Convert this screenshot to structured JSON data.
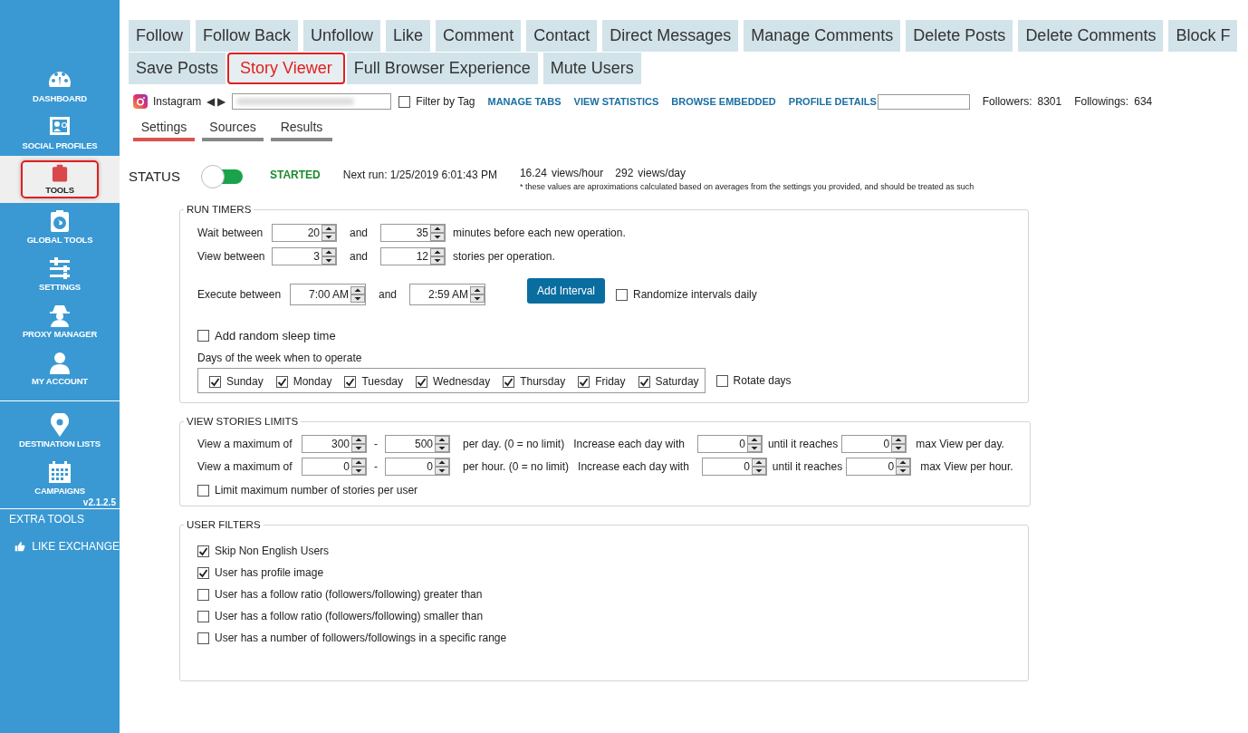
{
  "sidebar": {
    "groups": [
      [
        {
          "label": "DASHBOARD",
          "selected": false
        },
        {
          "label": "SOCIAL PROFILES",
          "selected": false
        },
        {
          "label": "TOOLS",
          "selected": true
        },
        {
          "label": "GLOBAL TOOLS",
          "selected": false
        },
        {
          "label": "SETTINGS",
          "selected": false
        },
        {
          "label": "PROXY MANAGER",
          "selected": false
        },
        {
          "label": "MY ACCOUNT",
          "selected": false
        }
      ],
      [
        {
          "label": "DESTINATION LISTS",
          "selected": false
        },
        {
          "label": "CAMPAIGNS",
          "selected": false
        }
      ]
    ],
    "version": "v2.1.2.5",
    "extra_title": "EXTRA TOOLS",
    "extra_items": [
      {
        "label": "LIKE EXCHANGE"
      }
    ]
  },
  "tab_rows": [
    [
      {
        "label": "Follow",
        "selected": false
      },
      {
        "label": "Follow Back",
        "selected": false
      },
      {
        "label": "Unfollow",
        "selected": false
      },
      {
        "label": "Like",
        "selected": false
      },
      {
        "label": "Comment",
        "selected": false
      },
      {
        "label": "Contact",
        "selected": false
      },
      {
        "label": "Direct Messages",
        "selected": false
      },
      {
        "label": "Manage Comments",
        "selected": false
      },
      {
        "label": "Delete Posts",
        "selected": false
      },
      {
        "label": "Delete Comments",
        "selected": false
      },
      {
        "label": "Block F",
        "selected": false
      }
    ],
    [
      {
        "label": "Save Posts",
        "selected": false
      },
      {
        "label": "Story Viewer",
        "selected": true
      },
      {
        "label": "Full Browser Experience",
        "selected": false
      },
      {
        "label": "Mute Users",
        "selected": false
      }
    ]
  ],
  "toolbar": {
    "network": "Instagram",
    "prev": "◀",
    "next": "▶",
    "filter_by_tag": {
      "label": "Filter by Tag",
      "checked": false
    },
    "links": [
      "MANAGE TABS",
      "VIEW STATISTICS",
      "BROWSE EMBEDDED",
      "PROFILE DETAILS"
    ],
    "followers_label": "Followers:",
    "followers": "8301",
    "followings_label": "Followings:",
    "followings": "634"
  },
  "sub_tabs": [
    {
      "label": "Settings",
      "selected": true
    },
    {
      "label": "Sources",
      "selected": false
    },
    {
      "label": "Results",
      "selected": false
    }
  ],
  "status": {
    "label": "STATUS",
    "on": true,
    "state": "STARTED",
    "next_run": "Next run: 1/25/2019 6:01:43 PM",
    "rate_hour": "16.24",
    "rate_hour_unit": "views/hour",
    "rate_day": "292",
    "rate_day_unit": "views/day",
    "note": "* these values are aproximations calculated based on averages from the settings you provided, and should be treated as such"
  },
  "run_timers": {
    "title": "RUN TIMERS",
    "ranges": [
      {
        "label": "Wait between",
        "from": "20",
        "and": "and",
        "to": "35",
        "suffix": "minutes before each new operation."
      },
      {
        "label": "View between",
        "from": "3",
        "and": "and",
        "to": "12",
        "suffix": "stories per operation."
      }
    ],
    "execute": {
      "label": "Execute between",
      "from": "7:00 AM",
      "and": "and",
      "to": "2:59 AM"
    },
    "add_interval": "Add Interval",
    "randomize": {
      "label": "Randomize intervals daily",
      "checked": false
    },
    "random_sleep": {
      "label": "Add random sleep time",
      "checked": false
    },
    "days_label": "Days of the week when to operate",
    "days": [
      {
        "label": "Sunday",
        "checked": true
      },
      {
        "label": "Monday",
        "checked": true
      },
      {
        "label": "Tuesday",
        "checked": true
      },
      {
        "label": "Wednesday",
        "checked": true
      },
      {
        "label": "Thursday",
        "checked": true
      },
      {
        "label": "Friday",
        "checked": true
      },
      {
        "label": "Saturday",
        "checked": true
      }
    ],
    "rotate_days": {
      "label": "Rotate days",
      "checked": false
    }
  },
  "limits": {
    "title": "VIEW STORIES LIMITS",
    "rows": [
      {
        "label": "View a maximum of",
        "from": "300",
        "dash": "-",
        "to": "500",
        "note": "per day. (0 = no limit)",
        "increase_label": "Increase each day with",
        "increase": "0",
        "until_label": "until it reaches",
        "until": "0",
        "suffix": "max View per day."
      },
      {
        "label": "View a maximum of",
        "from": "0",
        "dash": "-",
        "to": "0",
        "note": "per hour. (0 = no limit)",
        "increase_label": "Increase each day with",
        "increase": "0",
        "until_label": "until it reaches",
        "until": "0",
        "suffix": "max View per hour."
      }
    ],
    "per_user": {
      "label": "Limit maximum number of stories per user",
      "checked": false
    }
  },
  "user_filters": {
    "title": "USER FILTERS",
    "items": [
      {
        "label": "Skip Non English Users",
        "checked": true
      },
      {
        "label": "User has profile image",
        "checked": true
      },
      {
        "label": "User has a follow ratio (followers/following) greater than",
        "checked": false
      },
      {
        "label": "User has a follow ratio (followers/following) smaller than",
        "checked": false
      },
      {
        "label": "User has a number of followers/followings in a specific range",
        "checked": false
      }
    ]
  }
}
